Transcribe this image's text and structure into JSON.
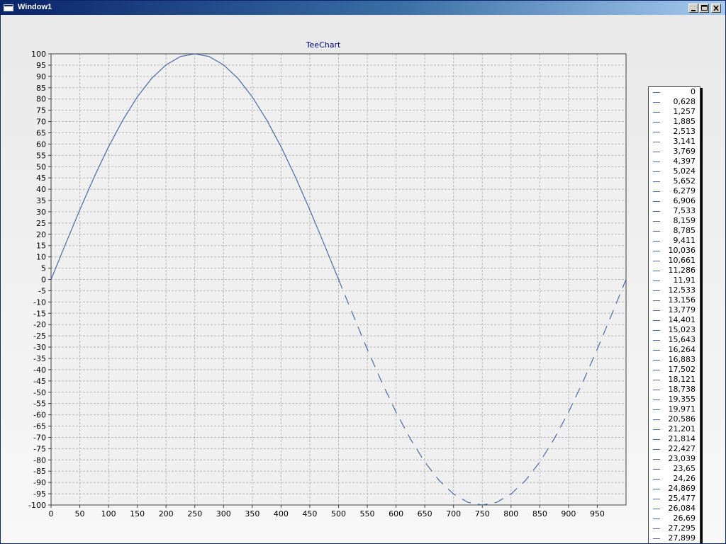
{
  "window": {
    "title": "Window1"
  },
  "chart_data": {
    "type": "line",
    "title": "TeeChart",
    "xlim": [
      0,
      1000
    ],
    "ylim": [
      -100,
      100
    ],
    "x_ticks": [
      0,
      50,
      100,
      150,
      200,
      250,
      300,
      350,
      400,
      450,
      500,
      550,
      600,
      650,
      700,
      750,
      800,
      850,
      900,
      950
    ],
    "y_ticks": [
      100,
      95,
      90,
      85,
      80,
      75,
      70,
      65,
      60,
      55,
      50,
      45,
      40,
      35,
      30,
      25,
      20,
      15,
      10,
      5,
      0,
      -5,
      -10,
      -15,
      -20,
      -25,
      -30,
      -35,
      -40,
      -45,
      -50,
      -55,
      -60,
      -65,
      -70,
      -75,
      -80,
      -85,
      -90,
      -95,
      -100
    ],
    "grid": true,
    "series_color": "#4a6aa5",
    "series": [
      {
        "x": [
          0,
          25,
          50,
          75,
          100,
          125,
          150,
          175,
          200,
          225,
          250,
          275,
          300,
          325,
          350,
          375,
          400,
          425,
          450,
          475,
          500
        ],
        "y": [
          0,
          15.6,
          30.9,
          45.4,
          58.8,
          70.7,
          80.9,
          89.1,
          95.1,
          98.8,
          100,
          98.8,
          95.1,
          89.1,
          80.9,
          70.7,
          58.8,
          45.4,
          30.9,
          15.6,
          0
        ]
      },
      {
        "style": "dashed",
        "x": [
          500,
          525,
          550,
          575,
          600,
          625,
          650,
          675,
          700,
          725,
          750,
          775,
          800,
          825,
          850,
          875,
          900,
          925,
          950,
          975,
          1000
        ],
        "y": [
          0,
          -15.6,
          -30.9,
          -45.4,
          -58.8,
          -70.7,
          -80.9,
          -89.1,
          -95.1,
          -98.8,
          -100,
          -98.8,
          -95.1,
          -89.1,
          -80.9,
          -70.7,
          -58.8,
          -45.4,
          -30.9,
          -15.6,
          0
        ]
      }
    ],
    "legend": {
      "placement": "right",
      "entries": [
        "0",
        "0,628",
        "1,257",
        "1,885",
        "2,513",
        "3,141",
        "3,769",
        "4,397",
        "5,024",
        "5,652",
        "6,279",
        "6,906",
        "7,533",
        "8,159",
        "8,785",
        "9,411",
        "10,036",
        "10,661",
        "11,286",
        "11,91",
        "12,533",
        "13,156",
        "13,779",
        "14,401",
        "15,023",
        "15,643",
        "16,264",
        "16,883",
        "17,502",
        "18,121",
        "18,738",
        "19,355",
        "19,971",
        "20,586",
        "21,201",
        "21,814",
        "22,427",
        "23,039",
        "23,65",
        "24,26",
        "24,869",
        "25,477",
        "26,084",
        "26,69",
        "27,295",
        "27,899"
      ]
    }
  }
}
